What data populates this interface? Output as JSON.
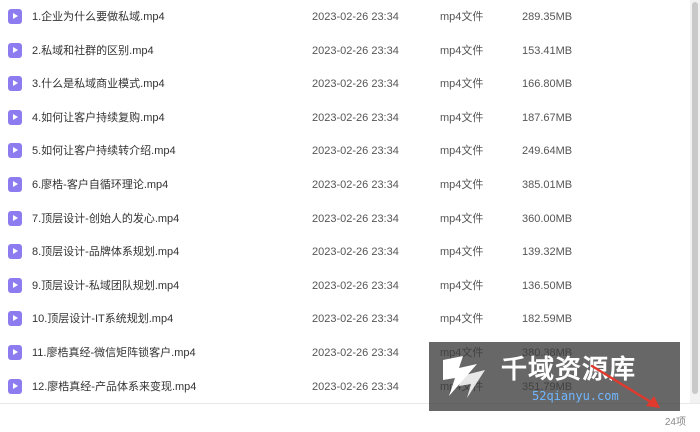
{
  "files": [
    {
      "name": "1.企业为什么要做私域.mp4",
      "date": "2023-02-26 23:34",
      "type": "mp4文件",
      "size": "289.35MB",
      "icon": "video-file-icon"
    },
    {
      "name": "2.私域和社群的区别.mp4",
      "date": "2023-02-26 23:34",
      "type": "mp4文件",
      "size": "153.41MB",
      "icon": "video-file-icon"
    },
    {
      "name": "3.什么是私域商业模式.mp4",
      "date": "2023-02-26 23:34",
      "type": "mp4文件",
      "size": "166.80MB",
      "icon": "video-file-icon"
    },
    {
      "name": "4.如何让客户持续复购.mp4",
      "date": "2023-02-26 23:34",
      "type": "mp4文件",
      "size": "187.67MB",
      "icon": "video-file-icon"
    },
    {
      "name": "5.如何让客户持续转介绍.mp4",
      "date": "2023-02-26 23:34",
      "type": "mp4文件",
      "size": "249.64MB",
      "icon": "video-file-icon"
    },
    {
      "name": "6.廖梏-客户自循环理论.mp4",
      "date": "2023-02-26 23:34",
      "type": "mp4文件",
      "size": "385.01MB",
      "icon": "video-file-icon"
    },
    {
      "name": "7.顶层设计-创始人的发心.mp4",
      "date": "2023-02-26 23:34",
      "type": "mp4文件",
      "size": "360.00MB",
      "icon": "video-file-icon"
    },
    {
      "name": "8.顶层设计-品牌体系规划.mp4",
      "date": "2023-02-26 23:34",
      "type": "mp4文件",
      "size": "139.32MB",
      "icon": "video-file-icon"
    },
    {
      "name": "9.顶层设计-私域团队规划.mp4",
      "date": "2023-02-26 23:34",
      "type": "mp4文件",
      "size": "136.50MB",
      "icon": "video-file-icon"
    },
    {
      "name": "10.顶层设计-IT系统规划.mp4",
      "date": "2023-02-26 23:34",
      "type": "mp4文件",
      "size": "182.59MB",
      "icon": "video-file-icon"
    },
    {
      "name": "11.廖梏真经-微信矩阵锁客户.mp4",
      "date": "2023-02-26 23:34",
      "type": "mp4文件",
      "size": "380.38MB",
      "icon": "video-file-icon"
    },
    {
      "name": "12.廖梏真经-产品体系来变现.mp4",
      "date": "2023-02-26 23:34",
      "type": "mp4文件",
      "size": "351.79MB",
      "icon": "video-file-icon"
    }
  ],
  "status": {
    "item_count": "24项"
  },
  "watermark": {
    "brand": "千域资源库",
    "site": "52qianyu.com",
    "site_color": "#6fb6ff"
  },
  "colors": {
    "file_icon": "#8d7cf0",
    "arrow": "#e03a2e"
  }
}
